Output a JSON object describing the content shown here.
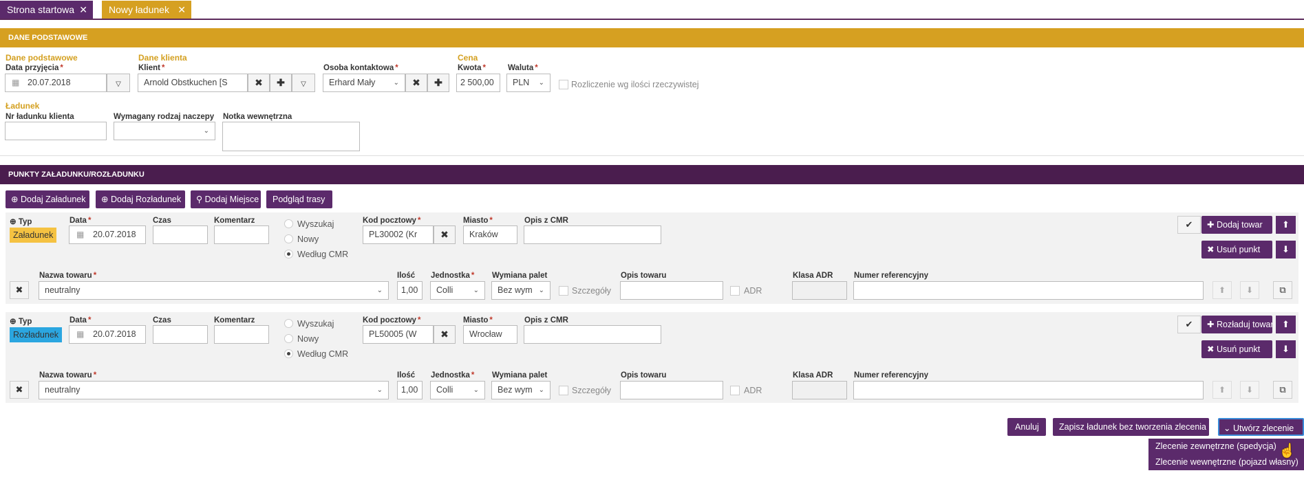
{
  "tabs": [
    {
      "label": "Strona startowa",
      "close": "✕"
    },
    {
      "label": "Nowy ładunek",
      "close": "✕"
    }
  ],
  "colors": {
    "gold": "#d6a021",
    "purple": "#4a1d4e",
    "button": "#5b2a6b",
    "load": "#f5c242",
    "unload": "#2ba6e0"
  },
  "basic": {
    "section": "DANE PODSTAWOWE",
    "group_basic": "Dane podstawowe",
    "date_label": "Data przyjęcia",
    "date_value": "20.07.2018",
    "group_client": "Dane klienta",
    "client_label": "Klient",
    "client_value": "Arnold Obstkuchen [S",
    "contact_label": "Osoba kontaktowa",
    "contact_value": "Erhard Mały",
    "group_price": "Cena",
    "amount_label": "Kwota",
    "amount_value": "2 500,00",
    "currency_label": "Waluta",
    "currency_value": "PLN",
    "settle_label": "Rozliczenie wg ilości rzeczywistej",
    "group_load": "Ładunek",
    "client_load_no_label": "Nr ładunku klienta",
    "trailer_label": "Wymagany rodzaj naczepy",
    "note_label": "Notka wewnętrzna",
    "req": "*"
  },
  "points": {
    "section": "PUNKTY ZAŁADUNKU/ROZŁADUNKU",
    "btn_add_load": "Dodaj Załadunek",
    "btn_add_unload": "Dodaj Rozładunek",
    "btn_add_place": "Dodaj Miejsce",
    "btn_preview": "Podgląd trasy",
    "labels": {
      "type": "Typ",
      "date": "Data",
      "time": "Czas",
      "comment": "Komentarz",
      "search": "Wyszukaj",
      "new": "Nowy",
      "by_cmr": "Według CMR",
      "postal": "Kod pocztowy",
      "city": "Miasto",
      "cmr_desc": "Opis z CMR",
      "goods_name": "Nazwa towaru",
      "qty": "Ilość",
      "unit": "Jednostka",
      "pallet": "Wymiana palet",
      "goods_desc": "Opis towaru",
      "adr_class": "Klasa ADR",
      "ref_no": "Numer referencyjny",
      "details": "Szczegóły",
      "adr": "ADR",
      "remove_point": "Usuń punkt"
    },
    "items": [
      {
        "type": "Załadunek",
        "date": "20.07.2018",
        "postal": "PL30002 (Kr",
        "city": "Kraków",
        "action": "Dodaj towar",
        "goods": {
          "name": "neutralny",
          "qty": "1,00",
          "unit": "Colli",
          "pallet": "Bez wym"
        }
      },
      {
        "type": "Rozładunek",
        "date": "20.07.2018",
        "postal": "PL50005 (W",
        "city": "Wrocław",
        "action": "Rozładuj towar",
        "goods": {
          "name": "neutralny",
          "qty": "1,00",
          "unit": "Colli",
          "pallet": "Bez wym"
        }
      }
    ]
  },
  "footer": {
    "cancel": "Anuluj",
    "save": "Zapisz ładunek bez tworzenia zlecenia",
    "create": "Utwórz zlecenie",
    "menu": [
      "Zlecenie zewnętrzne (spedycja)",
      "Zlecenie wewnętrzne (pojazd własny)"
    ]
  },
  "icons": [
    "close-icon",
    "calendar-icon",
    "chevron-down-icon",
    "times-icon",
    "plus-icon",
    "check-icon",
    "arrow-up-icon",
    "arrow-down-icon",
    "copy-icon",
    "map-marker-icon",
    "plus-circle-icon",
    "cursor-icon"
  ]
}
